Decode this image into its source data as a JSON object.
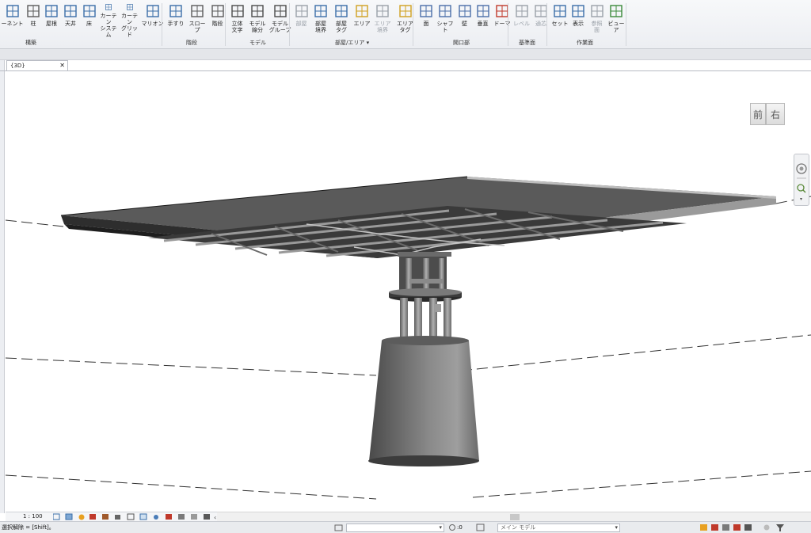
{
  "ribbon": {
    "tools": [
      {
        "key": "component",
        "label": "ーネント",
        "icon": "component-icon",
        "disabled": false
      },
      {
        "key": "column",
        "label": "柱",
        "icon": "column-icon",
        "disabled": false
      },
      {
        "key": "roof",
        "label": "屋根",
        "icon": "roof-icon",
        "disabled": false
      },
      {
        "key": "ceiling",
        "label": "天井",
        "icon": "ceiling-icon",
        "disabled": false
      },
      {
        "key": "floor",
        "label": "床",
        "icon": "floor-icon",
        "disabled": false
      },
      {
        "key": "curtain-system",
        "label": "カーテン\nシステム",
        "icon": "curtain-system-icon",
        "disabled": false
      },
      {
        "key": "curtain-grid",
        "label": "カーテン\nグリッド",
        "icon": "curtain-grid-icon",
        "disabled": false
      },
      {
        "key": "mullion",
        "label": "マリオン",
        "icon": "mullion-icon",
        "disabled": false
      },
      {
        "key": "railing",
        "label": "手すり",
        "icon": "railing-icon",
        "disabled": false
      },
      {
        "key": "ramp",
        "label": "スロープ",
        "icon": "ramp-icon",
        "disabled": false
      },
      {
        "key": "stair",
        "label": "階段",
        "icon": "stair-icon",
        "disabled": false
      },
      {
        "key": "model-text",
        "label": "立体\n文字",
        "icon": "model-text-icon",
        "disabled": false
      },
      {
        "key": "model-line",
        "label": "モデル\n線分",
        "icon": "model-line-icon",
        "disabled": false
      },
      {
        "key": "model-group",
        "label": "モデル\nグループ",
        "icon": "model-group-icon",
        "disabled": false
      },
      {
        "key": "room",
        "label": "部屋",
        "icon": "room-icon",
        "disabled": true
      },
      {
        "key": "room-separator",
        "label": "部屋\n境界",
        "icon": "room-separator-icon",
        "disabled": false
      },
      {
        "key": "room-tag",
        "label": "部屋\nタグ",
        "icon": "room-tag-icon",
        "disabled": false
      },
      {
        "key": "area",
        "label": "エリア",
        "icon": "area-icon",
        "disabled": false
      },
      {
        "key": "area-boundary",
        "label": "エリア\n境界",
        "icon": "area-boundary-icon",
        "disabled": true
      },
      {
        "key": "area-tag",
        "label": "エリア\nタグ",
        "icon": "area-tag-icon",
        "disabled": false
      },
      {
        "key": "by-face",
        "label": "面",
        "icon": "by-face-icon",
        "disabled": false
      },
      {
        "key": "shaft",
        "label": "シャフト",
        "icon": "shaft-icon",
        "disabled": false
      },
      {
        "key": "wall-opening",
        "label": "壁",
        "icon": "wall-opening-icon",
        "disabled": false
      },
      {
        "key": "vertical",
        "label": "垂直",
        "icon": "vertical-opening-icon",
        "disabled": false
      },
      {
        "key": "dormer",
        "label": "ドーマ",
        "icon": "dormer-icon",
        "disabled": false
      },
      {
        "key": "level",
        "label": "レベル",
        "icon": "level-icon",
        "disabled": true
      },
      {
        "key": "grid",
        "label": "通芯",
        "icon": "grid-icon",
        "disabled": true
      },
      {
        "key": "set",
        "label": "セット",
        "icon": "set-workplane-icon",
        "disabled": false
      },
      {
        "key": "show",
        "label": "表示",
        "icon": "show-workplane-icon",
        "disabled": false
      },
      {
        "key": "ref-plane",
        "label": "参照\n面",
        "icon": "ref-plane-icon",
        "disabled": true
      },
      {
        "key": "viewer",
        "label": "ビューア",
        "icon": "viewer-icon",
        "disabled": false
      }
    ],
    "panels": {
      "build": "構築",
      "circulation": "階段",
      "model": "モデル",
      "room_area": "部屋/エリア ▾",
      "opening": "開口部",
      "datum": "基準面",
      "work_plane": "作業面"
    }
  },
  "view_tab": {
    "title": "{3D}",
    "close": "✕"
  },
  "viewcube": {
    "front": "前",
    "right": "右"
  },
  "view_control": {
    "scale": "1 : 100"
  },
  "status": {
    "text": "選択解除 = [Shift]。",
    "coord_label": ":0",
    "model_field": "メイン モデル"
  },
  "colors": {
    "ribbon_bg": "#eceef2",
    "model_dark": "#3c3c3c",
    "model_mid": "#7a7a7a",
    "model_light": "#a9a9a9"
  }
}
